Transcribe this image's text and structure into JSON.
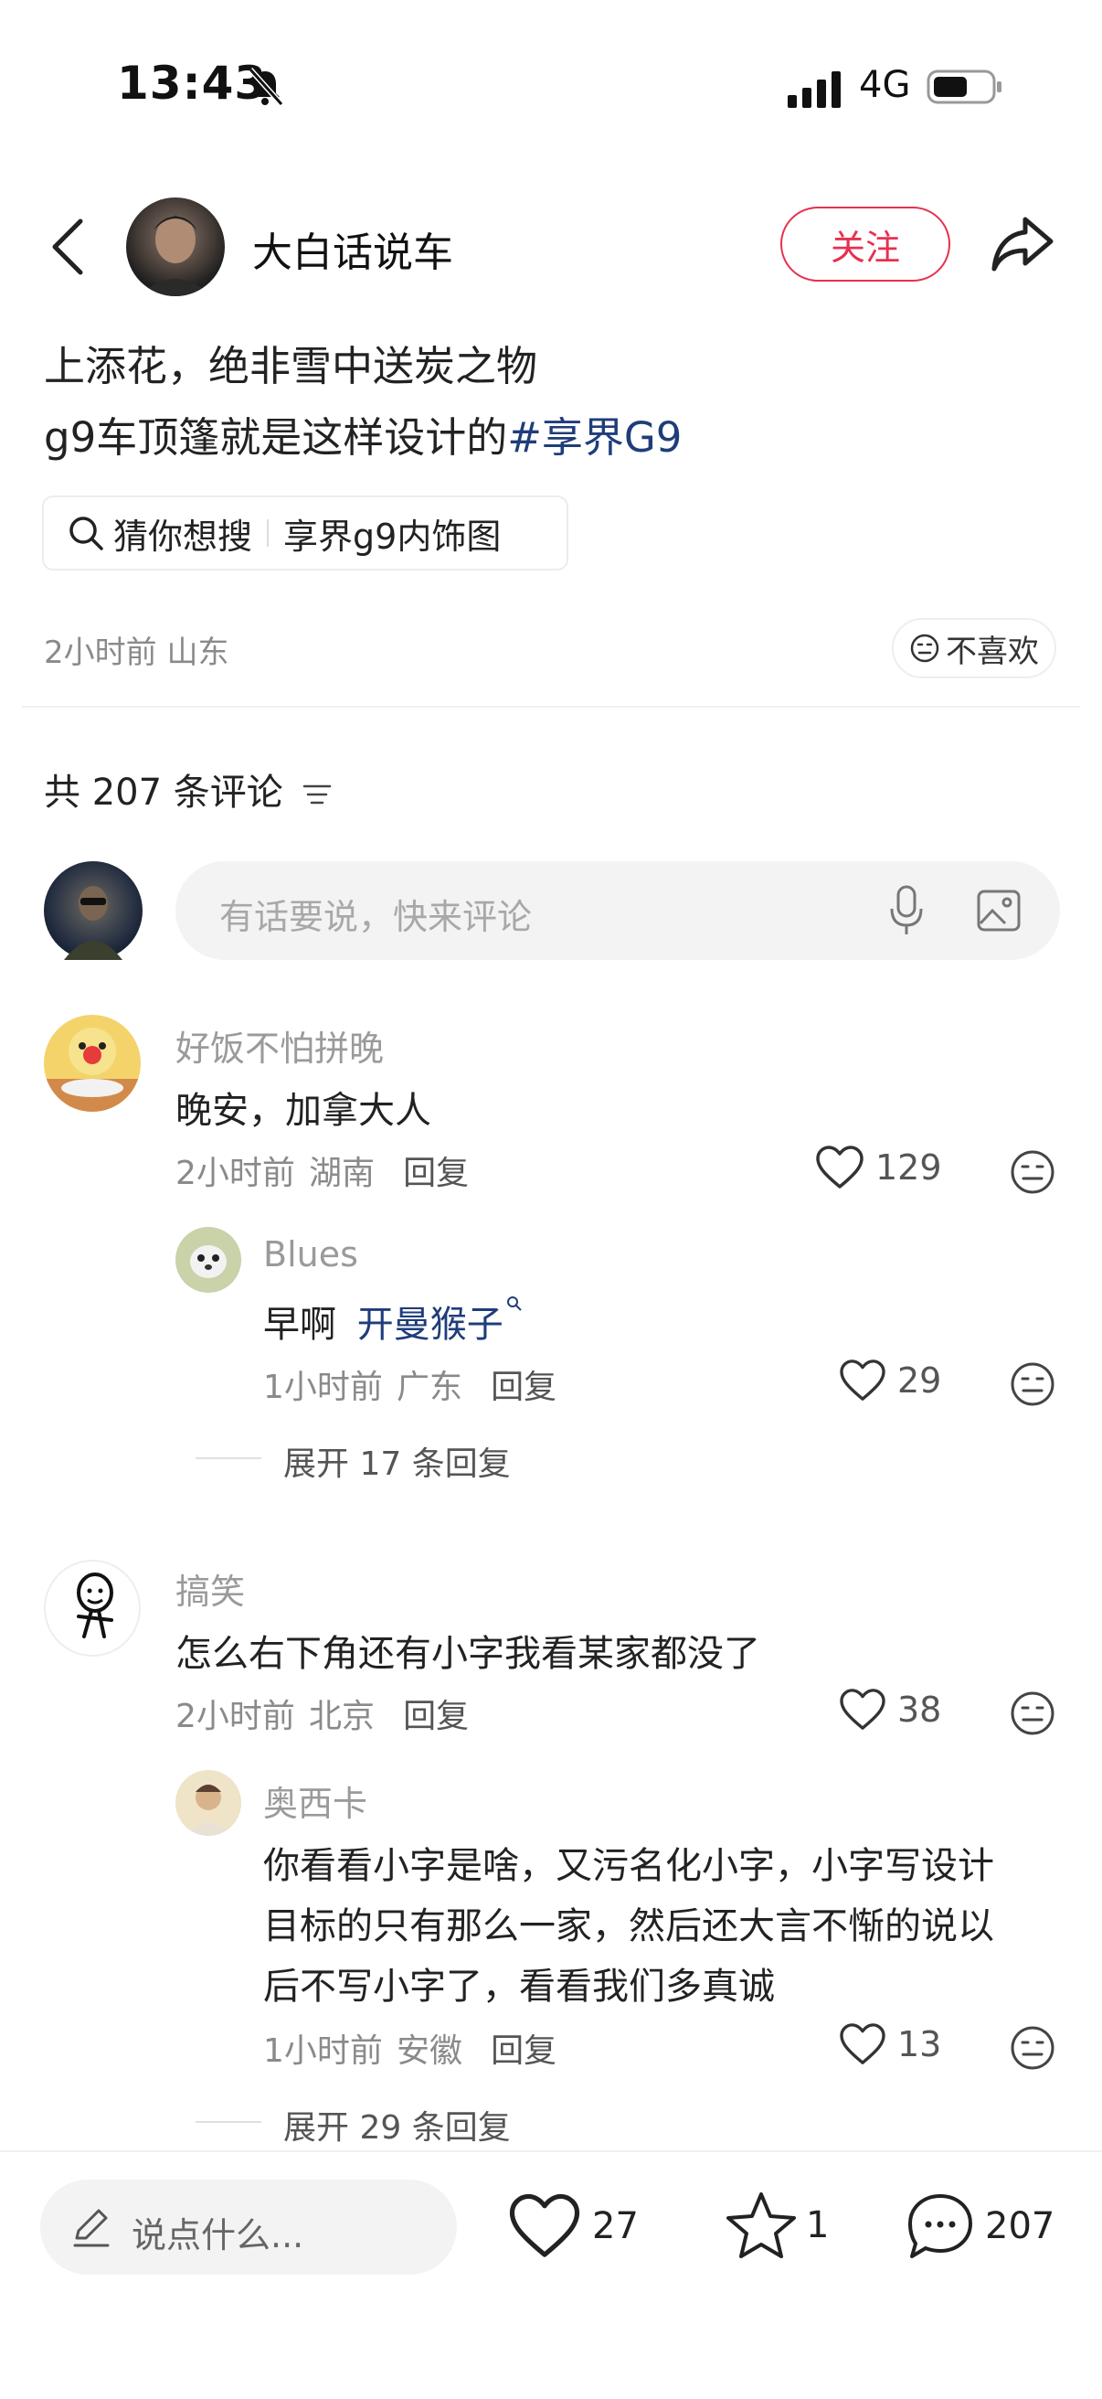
{
  "status_bar": {
    "time": "13:43",
    "network": "4G"
  },
  "header": {
    "author_name": "大白话说车",
    "follow_label": "关注"
  },
  "post": {
    "line1": "上添花，绝非雪中送炭之物",
    "line2_text": "g9车顶篷就是这样设计的",
    "line2_hashtag": "#享界G9"
  },
  "search_suggest": {
    "label": "猜你想搜",
    "query": "享界g9内饰图"
  },
  "post_meta": {
    "time_location": "2小时前 山东",
    "dislike_label": "不喜欢"
  },
  "comments_header": {
    "count_label": "共 207 条评论"
  },
  "comment_input": {
    "placeholder": "有话要说，快来评论"
  },
  "comments": [
    {
      "user": "好饭不怕拼晚",
      "text": "晚安，加拿大人",
      "time": "2小时前",
      "location": "湖南",
      "reply_label": "回复",
      "likes": "129",
      "replies": [
        {
          "user": "Blues",
          "text": "早啊",
          "mention": "开曼猴子",
          "time": "1小时前",
          "location": "广东",
          "reply_label": "回复",
          "likes": "29"
        }
      ],
      "expand_label": "展开 17 条回复"
    },
    {
      "user": "搞笑",
      "text": "怎么右下角还有小字我看某家都没了",
      "time": "2小时前",
      "location": "北京",
      "reply_label": "回复",
      "likes": "38",
      "replies": [
        {
          "user": "奥西卡",
          "text_lines": [
            "你看看小字是啥，又污名化小字，小字写设计",
            "目标的只有那么一家，然后还大言不惭的说以",
            "后不写小字了，看看我们多真诚"
          ],
          "time": "1小时前",
          "location": "安徽",
          "reply_label": "回复",
          "likes": "13"
        }
      ],
      "expand_label": "展开 29 条回复"
    }
  ],
  "bottom_bar": {
    "say_placeholder": "说点什么...",
    "likes": "27",
    "favorites": "1",
    "comments": "207"
  },
  "colors": {
    "accent": "#e8304f",
    "link": "#1f3d7a"
  }
}
